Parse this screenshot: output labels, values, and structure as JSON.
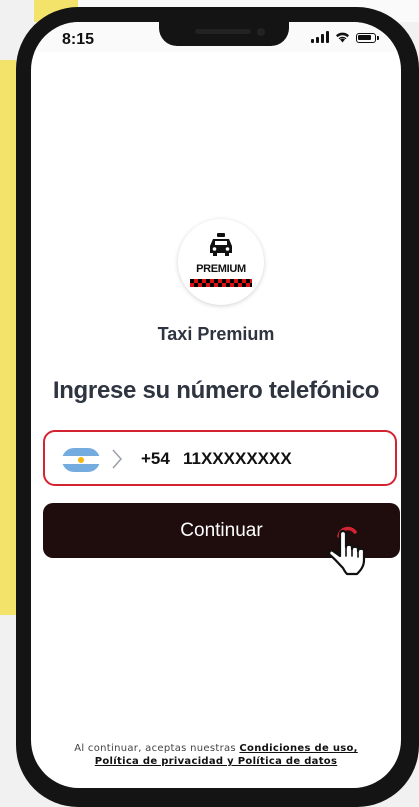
{
  "status_bar": {
    "time": "8:15",
    "icons": [
      "signal-icon",
      "wifi-icon",
      "battery-icon"
    ]
  },
  "brand": {
    "logo_text": "PREMIUM",
    "app_name": "Taxi Premium",
    "logo_icon": "taxi-car-icon"
  },
  "main": {
    "heading": "Ingrese su número telefónico"
  },
  "phone_input": {
    "country_flag": "argentina-flag-icon",
    "country_code": "+54",
    "value": "11XXXXXXXX"
  },
  "button": {
    "label": "Continuar"
  },
  "footer": {
    "prefix": "Al continuar, aceptas nuestras ",
    "terms_link": "Condiciones de uso,",
    "privacy_link": "Política de privacidad y Política de datos"
  },
  "colors": {
    "accent": "#d42331",
    "button": "#1f0c0c",
    "text": "#2e3440",
    "frame_accent": "#f4e36b"
  }
}
